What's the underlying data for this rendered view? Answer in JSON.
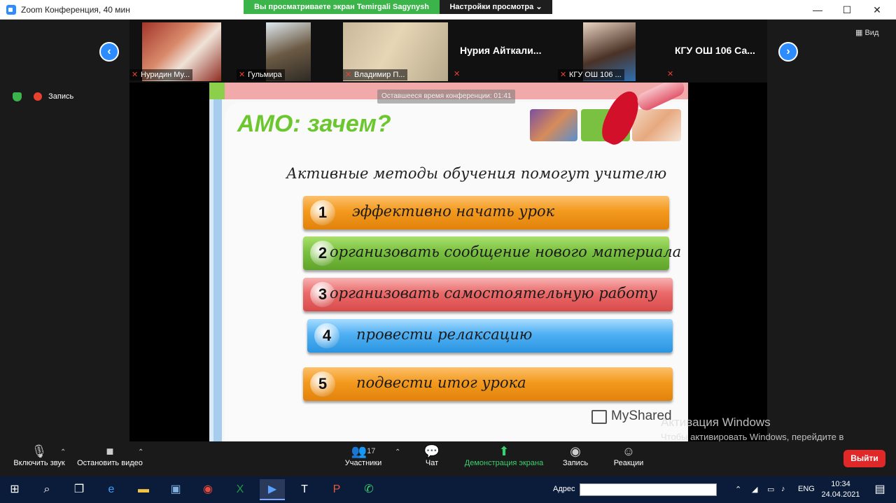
{
  "window": {
    "title": "Zoom Конференция, 40 мин",
    "share_banner": "Вы просматриваете экран Temirgali Sagynysh",
    "view_options": "Настройки просмотра ⌄",
    "minimize": "—",
    "maximize": "☐",
    "close": "✕"
  },
  "participants": [
    {
      "name": "Нуридин Му...",
      "type": "video"
    },
    {
      "name": "Гульмира",
      "type": "video"
    },
    {
      "name": "Владимир П...",
      "type": "video"
    },
    {
      "name": "Нурия  Айткали...",
      "type": "text"
    },
    {
      "name": "КГУ ОШ 106 ...",
      "type": "video"
    },
    {
      "name": "КГУ ОШ 106 Са...",
      "type": "text"
    }
  ],
  "nav": {
    "prev": "‹",
    "next": "›"
  },
  "view_button": "Вид",
  "recording_label": "Запись",
  "slide": {
    "time_left": "Оставшееся время конференции: 01:41",
    "title": "АМО: зачем?",
    "subtitle": "Активные методы обучения помогут  учителю",
    "items": [
      {
        "num": "1",
        "text": "эффективно начать урок",
        "color": "orange"
      },
      {
        "num": "2",
        "text": "организовать сообщение нового материала",
        "color": "green"
      },
      {
        "num": "3",
        "text": "организовать самостоятельную работу",
        "color": "red"
      },
      {
        "num": "4",
        "text": "провести релаксацию",
        "color": "blue"
      },
      {
        "num": "5",
        "text": "подвести итог урока",
        "color": "orange"
      }
    ],
    "watermark": "MyShared"
  },
  "toolbar": {
    "audio": "Включить звук",
    "video": "Остановить видео",
    "participants_count": "17",
    "participants": "Участники",
    "chat": "Чат",
    "share": "Демонстрация экрана",
    "record": "Запись",
    "reactions": "Реакции",
    "exit": "Выйти"
  },
  "activation": {
    "line1": "Активация Windows",
    "line2": "Чтобы активировать Windows, перейдите в раздел \"Параметры\"."
  },
  "taskbar": {
    "address_label": "Адрес",
    "lang": "ENG",
    "time": "10:34",
    "date": "24.04.2021"
  }
}
